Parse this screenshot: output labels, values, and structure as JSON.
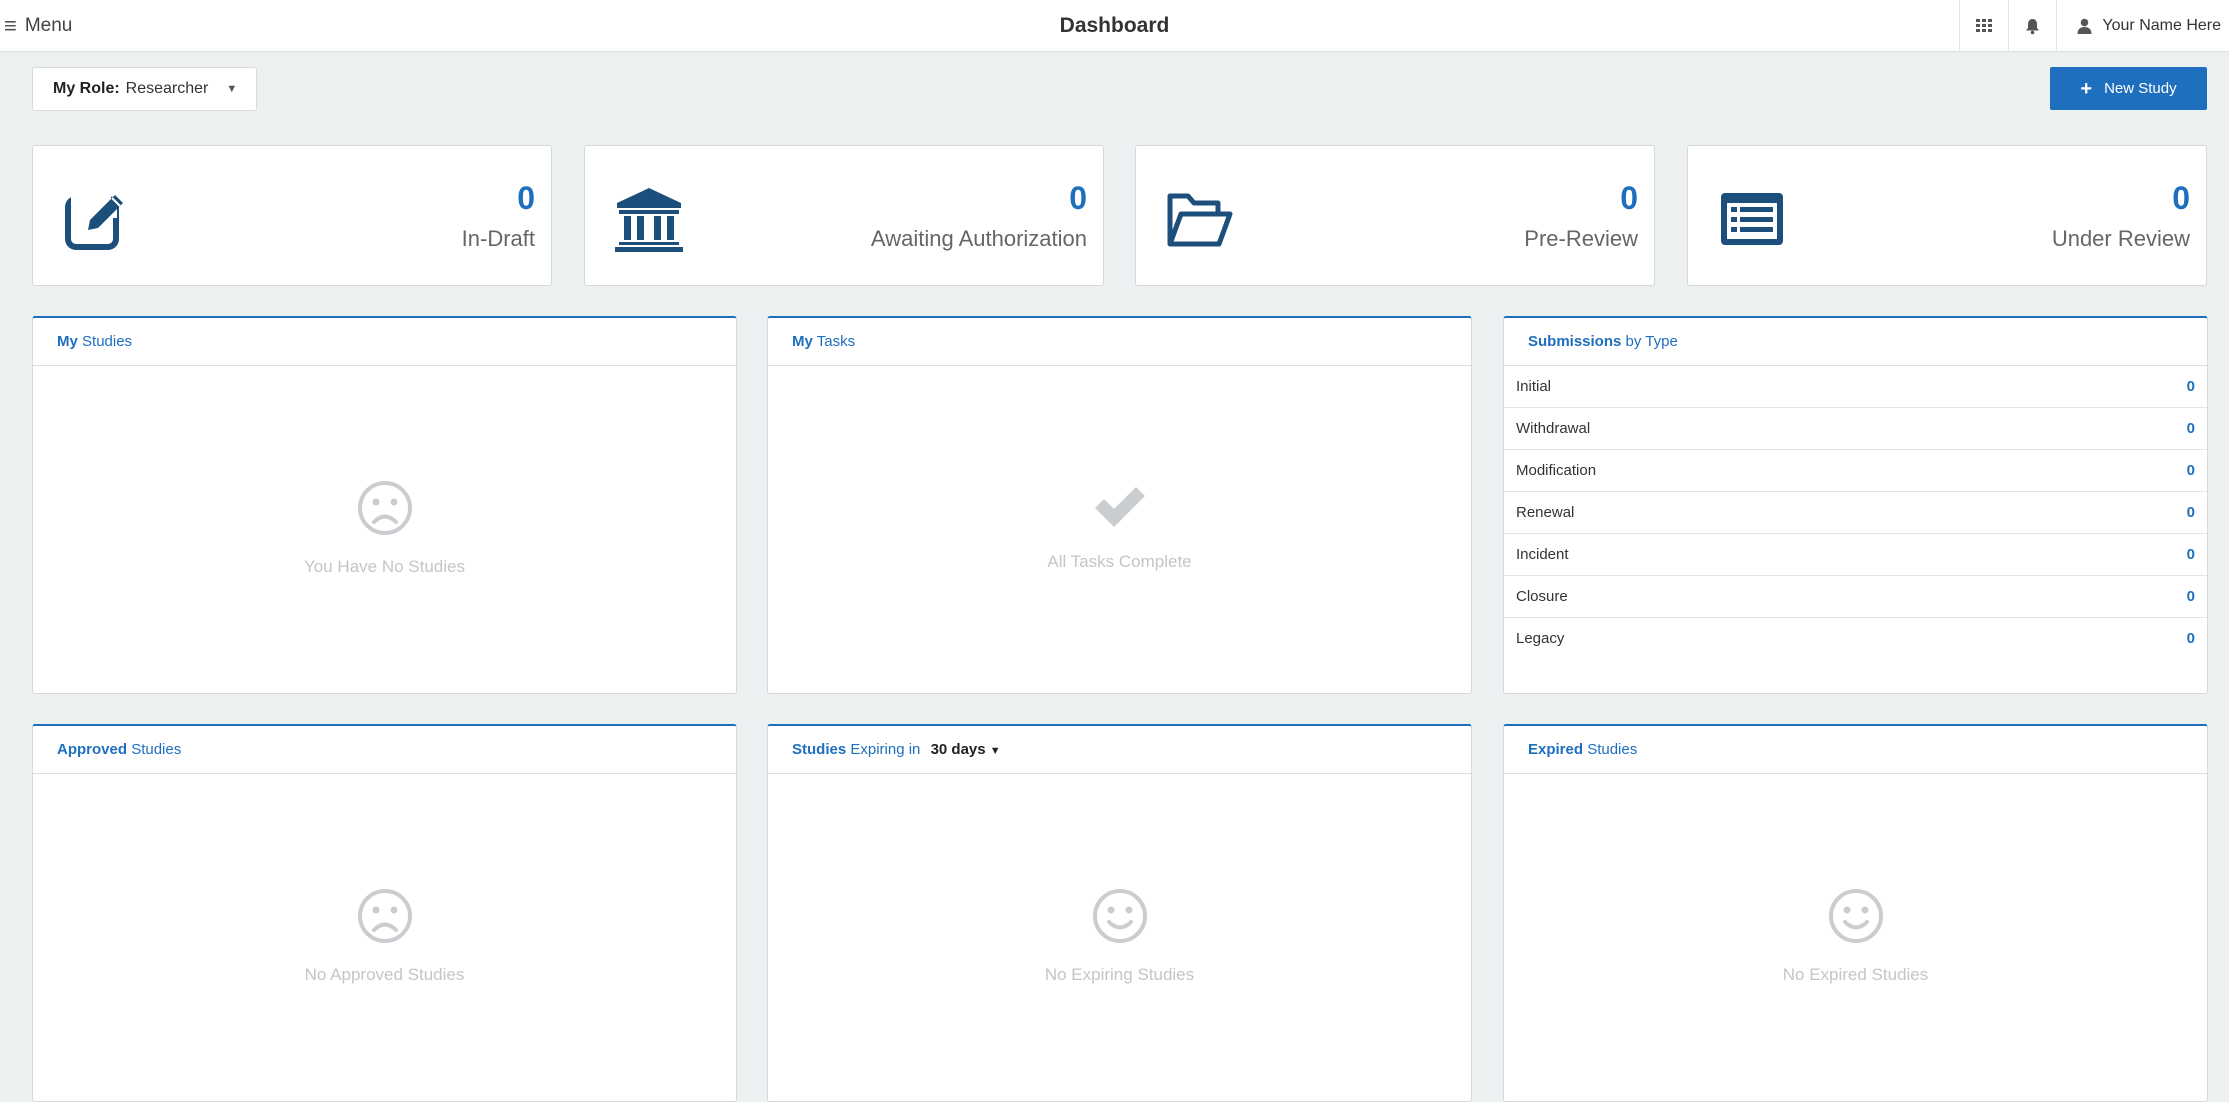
{
  "header": {
    "menu_label": "Menu",
    "title": "Dashboard",
    "user_name": "Your Name Here"
  },
  "toolbar": {
    "role_label": "My Role:",
    "role_value": "Researcher",
    "new_study_label": "New Study"
  },
  "stats": [
    {
      "count": "0",
      "label": "In-Draft",
      "icon": "edit-icon"
    },
    {
      "count": "0",
      "label": "Awaiting Authorization",
      "icon": "institution-icon"
    },
    {
      "count": "0",
      "label": "Pre-Review",
      "icon": "folder-open-icon"
    },
    {
      "count": "0",
      "label": "Under Review",
      "icon": "list-alt-icon"
    }
  ],
  "panels": {
    "my_studies": {
      "title_bold": "My",
      "title_rest": "Studies",
      "empty": "You Have No Studies"
    },
    "my_tasks": {
      "title_bold": "My",
      "title_rest": "Tasks",
      "empty": "All Tasks Complete"
    },
    "submissions": {
      "title_bold": "Submissions",
      "title_rest": "by Type",
      "rows": [
        {
          "label": "Initial",
          "count": "0"
        },
        {
          "label": "Withdrawal",
          "count": "0"
        },
        {
          "label": "Modification",
          "count": "0"
        },
        {
          "label": "Renewal",
          "count": "0"
        },
        {
          "label": "Incident",
          "count": "0"
        },
        {
          "label": "Closure",
          "count": "0"
        },
        {
          "label": "Legacy",
          "count": "0"
        }
      ]
    },
    "approved": {
      "title_bold": "Approved",
      "title_rest": "Studies",
      "empty": "No Approved Studies"
    },
    "expiring": {
      "title_bold": "Studies",
      "title_rest": "Expiring in",
      "days": "30 days",
      "empty": "No Expiring Studies"
    },
    "expired": {
      "title_bold": "Expired",
      "title_rest": "Studies",
      "empty": "No Expired Studies"
    }
  },
  "colors": {
    "accent": "#1f6fbf",
    "icon_dark": "#1d4f7c",
    "muted_icon": "#c9cdd0",
    "background": "#edf0f1"
  }
}
